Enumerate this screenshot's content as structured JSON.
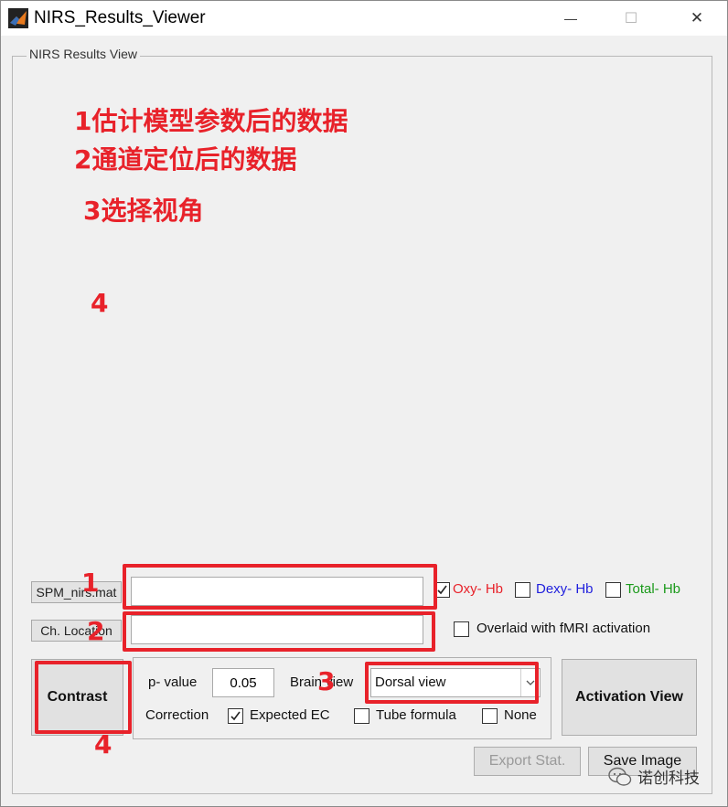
{
  "window": {
    "title": "NIRS_Results_Viewer",
    "minimize_glyph": "—",
    "maximize_glyph": "☐",
    "close_glyph": "✕"
  },
  "panel": {
    "title": "NIRS Results View"
  },
  "annotations": {
    "line1": "1估计模型参数后的数据",
    "line2": "2通道定位后的数据",
    "line3": "3选择视角",
    "n4_top": "4",
    "n1": "1",
    "n2": "2",
    "n3": "3",
    "n4_bottom": "4"
  },
  "files": {
    "spm_label": "SPM_nirs.mat",
    "spm_value": "",
    "ch_label": "Ch. Location",
    "ch_value": ""
  },
  "hb": {
    "oxy": {
      "label": "Oxy- Hb",
      "checked": true,
      "color": "#e8222a"
    },
    "dexy": {
      "label": "Dexy- Hb",
      "checked": false,
      "color": "#1f1fdd"
    },
    "total": {
      "label": "Total- Hb",
      "checked": false,
      "color": "#1a9a1a"
    }
  },
  "overlay": {
    "label": "Overlaid with fMRI activation",
    "checked": false
  },
  "contrast": {
    "label": "Contrast"
  },
  "params": {
    "p_label": "p- value",
    "p_value": "0.05",
    "brain_view_label": "Brain view",
    "brain_view_selected": "Dorsal view",
    "correction_label": "Correction",
    "expected_ec": {
      "label": "Expected EC",
      "checked": true
    },
    "tube_formula": {
      "label": "Tube formula",
      "checked": false
    },
    "none": {
      "label": "None",
      "checked": false
    }
  },
  "actions": {
    "activation_view": "Activation View",
    "export_stat": "Export Stat.",
    "save_image": "Save Image"
  },
  "watermark": {
    "text": "诺创科技"
  }
}
